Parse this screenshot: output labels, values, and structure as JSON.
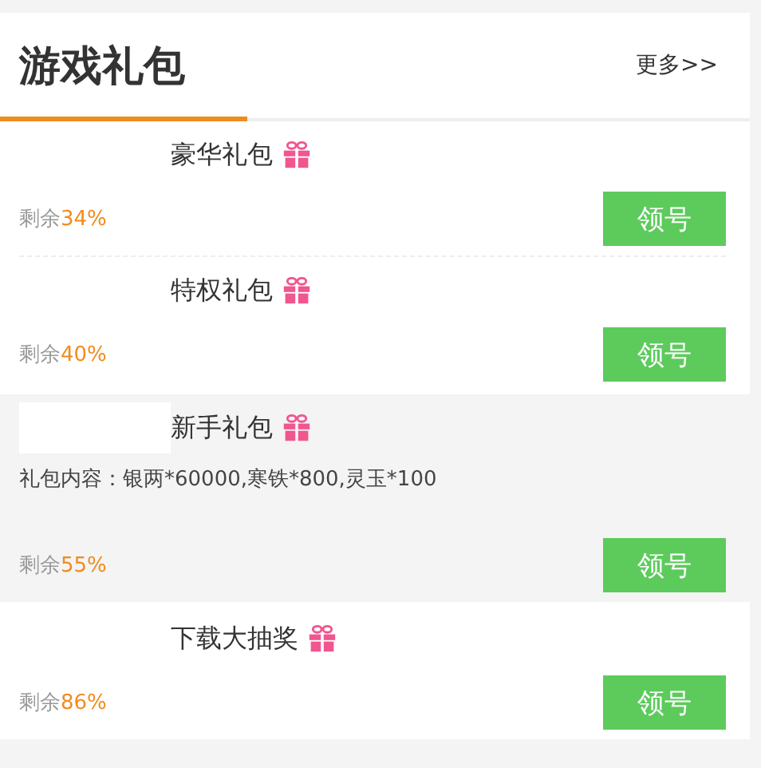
{
  "header": {
    "title": "游戏礼包",
    "more_link": "更多>>"
  },
  "gifts": [
    {
      "title": "豪华礼包",
      "remain_label": "剩余",
      "remain_value": "34%",
      "button": "领号"
    },
    {
      "title": "特权礼包",
      "remain_label": "剩余",
      "remain_value": "40%",
      "button": "领号"
    },
    {
      "title": "新手礼包",
      "content": "礼包内容：银两*60000,寒铁*800,灵玉*100",
      "remain_label": "剩余",
      "remain_value": "55%",
      "button": "领号"
    },
    {
      "title": "下载大抽奖",
      "remain_label": "剩余",
      "remain_value": "86%",
      "button": "领号"
    }
  ]
}
